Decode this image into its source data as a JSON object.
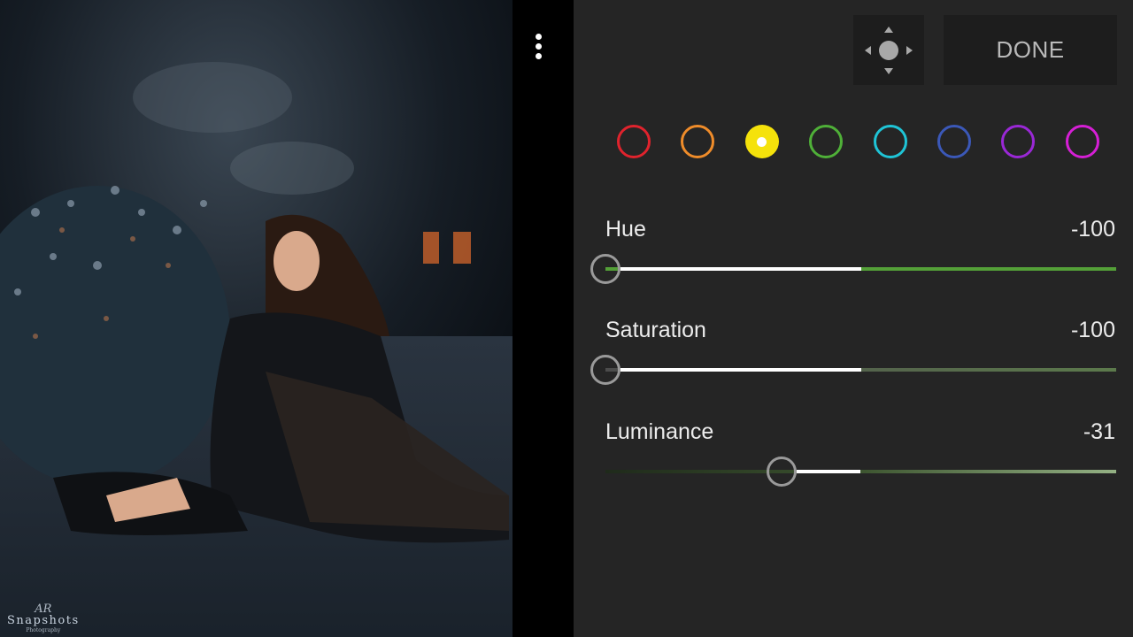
{
  "photo": {
    "description_icon": "photo-preview",
    "watermark": {
      "script": "AR",
      "brand": "Snapshots",
      "sub": "Photography"
    }
  },
  "toolbar": {
    "more_icon": "more-vertical-icon",
    "move_icon": "move-target-icon",
    "done_label": "DONE"
  },
  "colors": {
    "panel_bg": "#252525",
    "accent_track": "#54a038",
    "swatches": [
      {
        "name": "red",
        "color": "#e0232d",
        "selected": false
      },
      {
        "name": "orange",
        "color": "#ef8c2a",
        "selected": false
      },
      {
        "name": "yellow",
        "color": "#f5e20b",
        "selected": true
      },
      {
        "name": "green",
        "color": "#4fb038",
        "selected": false
      },
      {
        "name": "aqua",
        "color": "#1fc4d6",
        "selected": false
      },
      {
        "name": "blue",
        "color": "#3b58b8",
        "selected": false
      },
      {
        "name": "purple",
        "color": "#9a28d6",
        "selected": false
      },
      {
        "name": "magenta",
        "color": "#d61fd6",
        "selected": false
      }
    ]
  },
  "sliders": [
    {
      "key": "hue",
      "label": "Hue",
      "value": "-100",
      "numeric": -100,
      "min": -100,
      "max": 100
    },
    {
      "key": "saturation",
      "label": "Saturation",
      "value": "-100",
      "numeric": -100,
      "min": -100,
      "max": 100
    },
    {
      "key": "luminance",
      "label": "Luminance",
      "value": "-31",
      "numeric": -31,
      "min": -100,
      "max": 100
    }
  ]
}
